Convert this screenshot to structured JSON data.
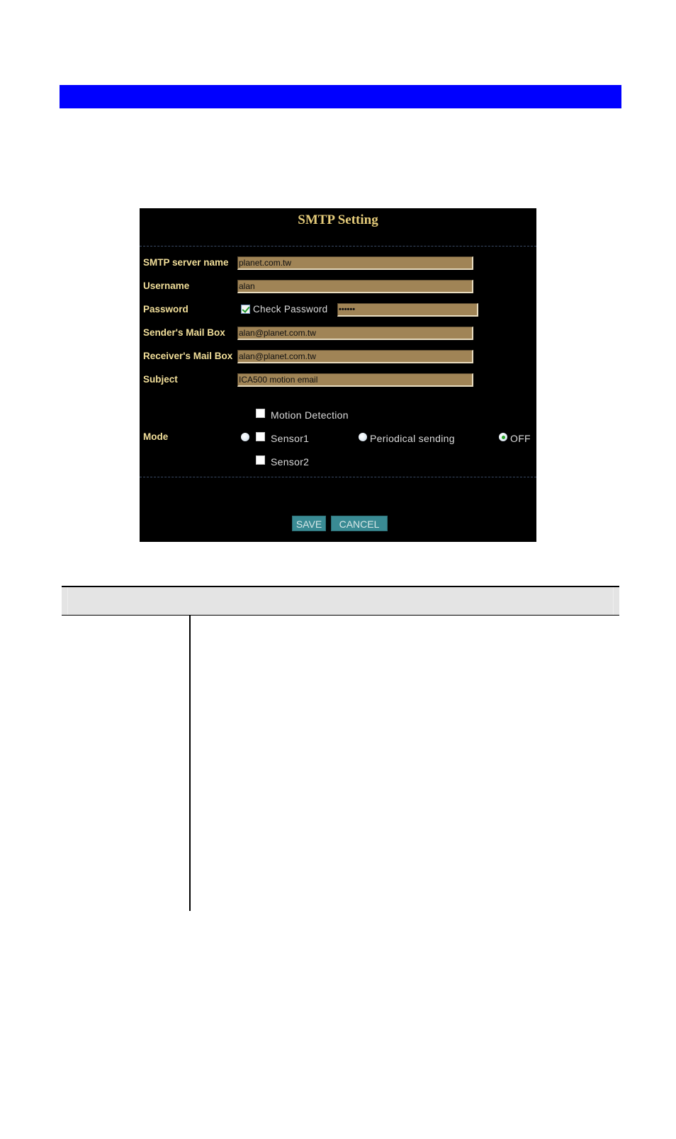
{
  "header_bar": {
    "color": "#0000ff"
  },
  "smtp_panel": {
    "title": "SMTP Setting",
    "colors": {
      "background": "#000000",
      "title": "#e6cc7a",
      "label": "#f2df9a",
      "field_bg": "#a08456",
      "button_bg": "#3a8b94"
    },
    "fields": {
      "server_name": {
        "label": "SMTP server name",
        "value": "planet.com.tw"
      },
      "username": {
        "label": "Username",
        "value": "alan"
      },
      "password": {
        "label": "Password",
        "check_label": "Check Password",
        "check_checked": true,
        "value": "••••••"
      },
      "sender": {
        "label": "Sender's Mail Box",
        "value": "alan@planet.com.tw"
      },
      "receiver": {
        "label": "Receiver's Mail Box",
        "value": "alan@planet.com.tw"
      },
      "subject": {
        "label": "Subject",
        "value": "ICA500 motion email"
      }
    },
    "mode": {
      "label": "Mode",
      "event_radio_selected": false,
      "event_options": [
        {
          "label": "Motion Detection",
          "checked": false
        },
        {
          "label": "Sensor1",
          "checked": false
        },
        {
          "label": "Sensor2",
          "checked": false
        }
      ],
      "periodical": {
        "label": "Periodical sending",
        "selected": false
      },
      "off": {
        "label": "OFF",
        "selected": true
      }
    },
    "buttons": {
      "save": "SAVE",
      "cancel": "CANCEL"
    }
  },
  "table": {
    "header_bg": "#e4e4e4"
  }
}
